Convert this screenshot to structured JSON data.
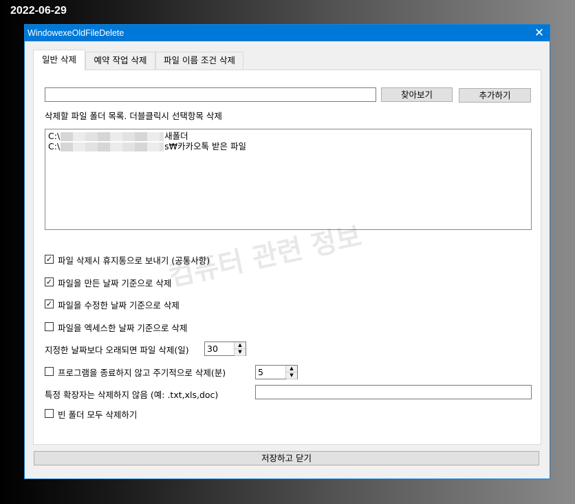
{
  "date_stamp": "2022-06-29",
  "window": {
    "title": "WindowexeOldFileDelete",
    "close_glyph": "✕"
  },
  "tabs": [
    {
      "label": "일반 삭제",
      "active": true
    },
    {
      "label": "예약 작업 삭제",
      "active": false
    },
    {
      "label": "파일 이름 조건 삭제",
      "active": false
    }
  ],
  "path_input": {
    "value": ""
  },
  "buttons": {
    "browse": "찾아보기",
    "add": "추가하기",
    "save_close": "저장하고 닫기"
  },
  "folder_list": {
    "label": "삭제할 파일 폴더 목록. 더블클릭시 선택항목 삭제",
    "items": [
      {
        "prefix": "C:\\",
        "suffix": "새폴더"
      },
      {
        "prefix": "C:\\",
        "suffix": "s₩카카오톡 받은 파일"
      }
    ]
  },
  "options": {
    "recycle": {
      "label": "파일 삭제시 휴지통으로 보내기 (공통사항)",
      "checked": true
    },
    "created": {
      "label": "파일을 만든 날짜 기준으로 삭제",
      "checked": true
    },
    "modified": {
      "label": "파일을 수정한 날짜 기준으로 삭제",
      "checked": true
    },
    "accessed": {
      "label": "파일을 엑세스한 날짜 기준으로 삭제",
      "checked": false
    },
    "days_label": "지정한 날짜보다 오래되면 파일 삭제(일)",
    "days_value": "30",
    "periodic": {
      "label": "프로그램을 종료하지 않고 주기적으로 삭제(분)",
      "checked": false
    },
    "periodic_value": "5",
    "exclude_label": "특정 확장자는 삭제하지 않음 (예: .txt,xls,doc)",
    "exclude_value": "",
    "empty_folders": {
      "label": "빈 폴더 모두 삭제하기",
      "checked": false
    }
  },
  "watermark": "컴퓨터 관련 정보",
  "check_glyph": "✓"
}
